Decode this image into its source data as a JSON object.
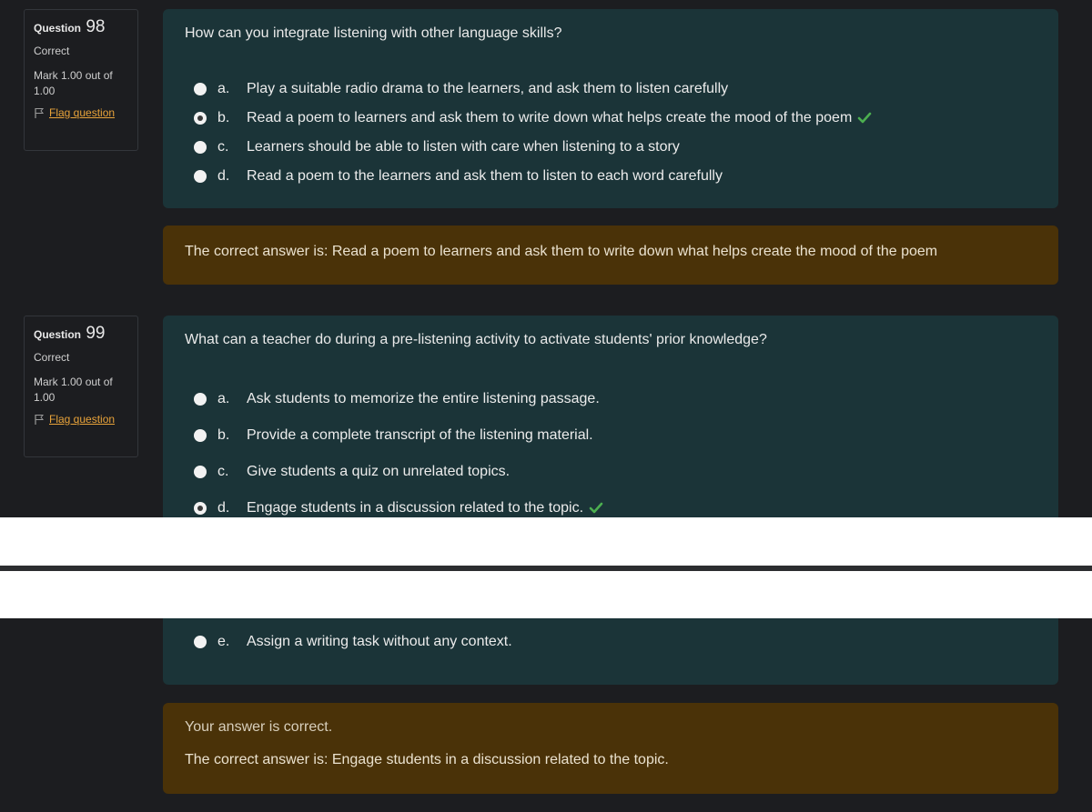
{
  "questions": [
    {
      "label": "Question",
      "number": "98",
      "state": "Correct",
      "mark": "Mark 1.00 out of 1.00",
      "flag_label": "Flag question",
      "text": "How can you integrate listening with other language skills?",
      "answers": [
        {
          "letter": "a.",
          "text": "Play a suitable radio drama to the learners, and ask them to listen carefully",
          "selected": false,
          "correct": false
        },
        {
          "letter": "b.",
          "text": "Read a poem to learners and ask them to write down what helps create the mood of the poem",
          "selected": true,
          "correct": true
        },
        {
          "letter": "c.",
          "text": "Learners should be able to listen with care when listening to a story",
          "selected": false,
          "correct": false
        },
        {
          "letter": "d.",
          "text": "Read a poem to the learners and ask them to listen to each word carefully",
          "selected": false,
          "correct": false
        }
      ],
      "feedback": [
        "The correct answer is: Read a poem to learners and ask them to write down what helps create the mood of the poem"
      ]
    },
    {
      "label": "Question",
      "number": "99",
      "state": "Correct",
      "mark": "Mark 1.00 out of 1.00",
      "flag_label": "Flag question",
      "text": "What can a teacher do during a pre-listening activity to activate students' prior knowledge?",
      "answers": [
        {
          "letter": "a.",
          "text": "Ask students to memorize the entire listening passage.",
          "selected": false,
          "correct": false
        },
        {
          "letter": "b.",
          "text": "Provide a complete transcript of the listening material.",
          "selected": false,
          "correct": false
        },
        {
          "letter": "c.",
          "text": "Give students a quiz on unrelated topics.",
          "selected": false,
          "correct": false
        },
        {
          "letter": "d.",
          "text": "Engage students in a discussion related to the topic.",
          "selected": true,
          "correct": true
        },
        {
          "letter": "e.",
          "text": "Assign a writing task without any context.",
          "selected": false,
          "correct": false
        }
      ],
      "feedback": [
        "Your answer is correct.",
        "The correct answer is: Engage students in a discussion related to the topic."
      ]
    }
  ],
  "colors": {
    "page_bg": "#1c1d20",
    "formulation_bg": "#1b3438",
    "feedback_bg": "#4a3208",
    "flag_link": "#e8a33a",
    "check": "#4caf50"
  }
}
